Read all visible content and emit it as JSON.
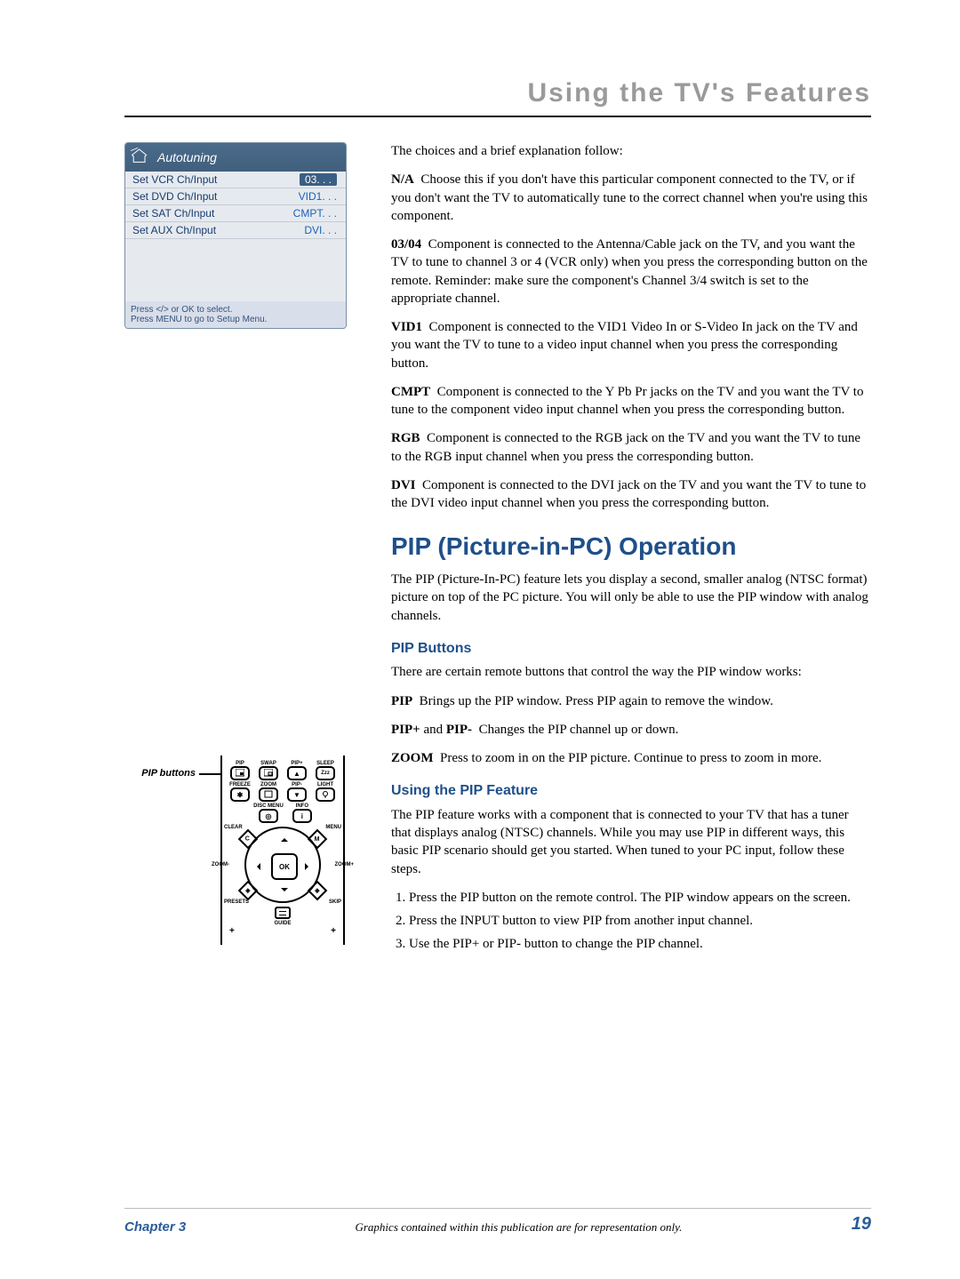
{
  "header": {
    "title": "Using the TV's Features"
  },
  "menu": {
    "title": "Autotuning",
    "rows": [
      {
        "key": "Set VCR Ch/Input",
        "val": "03. . ."
      },
      {
        "key": "Set DVD Ch/Input",
        "val": "VID1. . ."
      },
      {
        "key": "Set SAT Ch/Input",
        "val": "CMPT. . ."
      },
      {
        "key": "Set AUX Ch/Input",
        "val": "DVI. . ."
      }
    ],
    "foot1": "Press </> or OK to select.",
    "foot2": "Press MENU to go to Setup Menu."
  },
  "body": {
    "intro": "The choices and a brief explanation follow:",
    "na_term": "N/A",
    "na": "Choose this if you don't have this particular component connected to the TV, or if you don't want the TV to automatically tune to the correct channel when you're using this component.",
    "o3_term": "03/04",
    "o3": "Component is connected to the Antenna/Cable jack on the TV, and you want the TV to tune to channel 3 or 4 (VCR only) when you press the corresponding button on the remote. Reminder: make sure the component's Channel 3/4 switch is set to the appropriate channel.",
    "vid1_term": "VID1",
    "vid1": "Component is connected to the VID1 Video In or S-Video In jack on the TV and you want the TV to tune to a video input channel when you press the corresponding button.",
    "cmpt_term": "CMPT",
    "cmpt": "Component is connected to the Y Pb Pr jacks on the TV and you want the TV to tune to the component video input channel when you press the corresponding button.",
    "rgb_term": "RGB",
    "rgb": "Component is connected to the RGB jack on the TV and you want the TV to tune to the RGB input channel when you press the corresponding button.",
    "dvi_term": "DVI",
    "dvi": "Component is connected to the DVI jack on the TV and you want the TV to tune to the DVI video input channel when you press the corresponding button.",
    "pip_title": "PIP (Picture-in-PC) Operation",
    "pip_intro": "The PIP (Picture-In-PC) feature lets you display a second, smaller analog (NTSC format) picture on top of the PC picture. You will only be able to use the PIP window with analog channels.",
    "pip_buttons_title": "PIP Buttons",
    "pip_buttons_intro": "There are certain remote buttons that control the way the PIP window works:",
    "pip_term": "PIP",
    "pip_desc": "Brings up the PIP window. Press PIP again to remove the window.",
    "pipplus_term": "PIP+",
    "pipminus_term": "PIP-",
    "and": " and ",
    "pipplus_desc": "Changes the PIP channel up or down.",
    "zoom_term": "ZOOM",
    "zoom_desc": "Press to zoom in on the PIP picture. Continue to press to zoom in more.",
    "using_title": "Using the PIP Feature",
    "using_intro": "The PIP feature works with a component that is connected to your TV that has a tuner that displays analog (NTSC) channels. While you may use PIP in different ways, this basic PIP scenario should get you started. When tuned to your PC input, follow these steps.",
    "step1": "Press the PIP button on the remote control. The PIP window appears on the screen.",
    "step2": "Press the INPUT button to view PIP from another input channel.",
    "step3": "Use the PIP+ or PIP- button to change the PIP channel."
  },
  "remote": {
    "label": "PIP buttons",
    "r1": [
      "PIP",
      "SWAP",
      "PIP+",
      "SLEEP"
    ],
    "r2": [
      "FREEZE",
      "ZOOM",
      "PIP-",
      "LIGHT"
    ],
    "mid": [
      "DISC MENU",
      "INFO"
    ],
    "corners": {
      "clear": "CLEAR",
      "menu": "MENU",
      "presets": "PRESETS",
      "skip": "SKIP"
    },
    "sides": {
      "zoomn": "ZOOM-",
      "zoomp": "ZOOM+"
    },
    "ok": "OK",
    "guide": "GUIDE",
    "plus": "+"
  },
  "footer": {
    "left": "Chapter 3",
    "mid": "Graphics contained within this publication are for representation only.",
    "right": "19"
  }
}
